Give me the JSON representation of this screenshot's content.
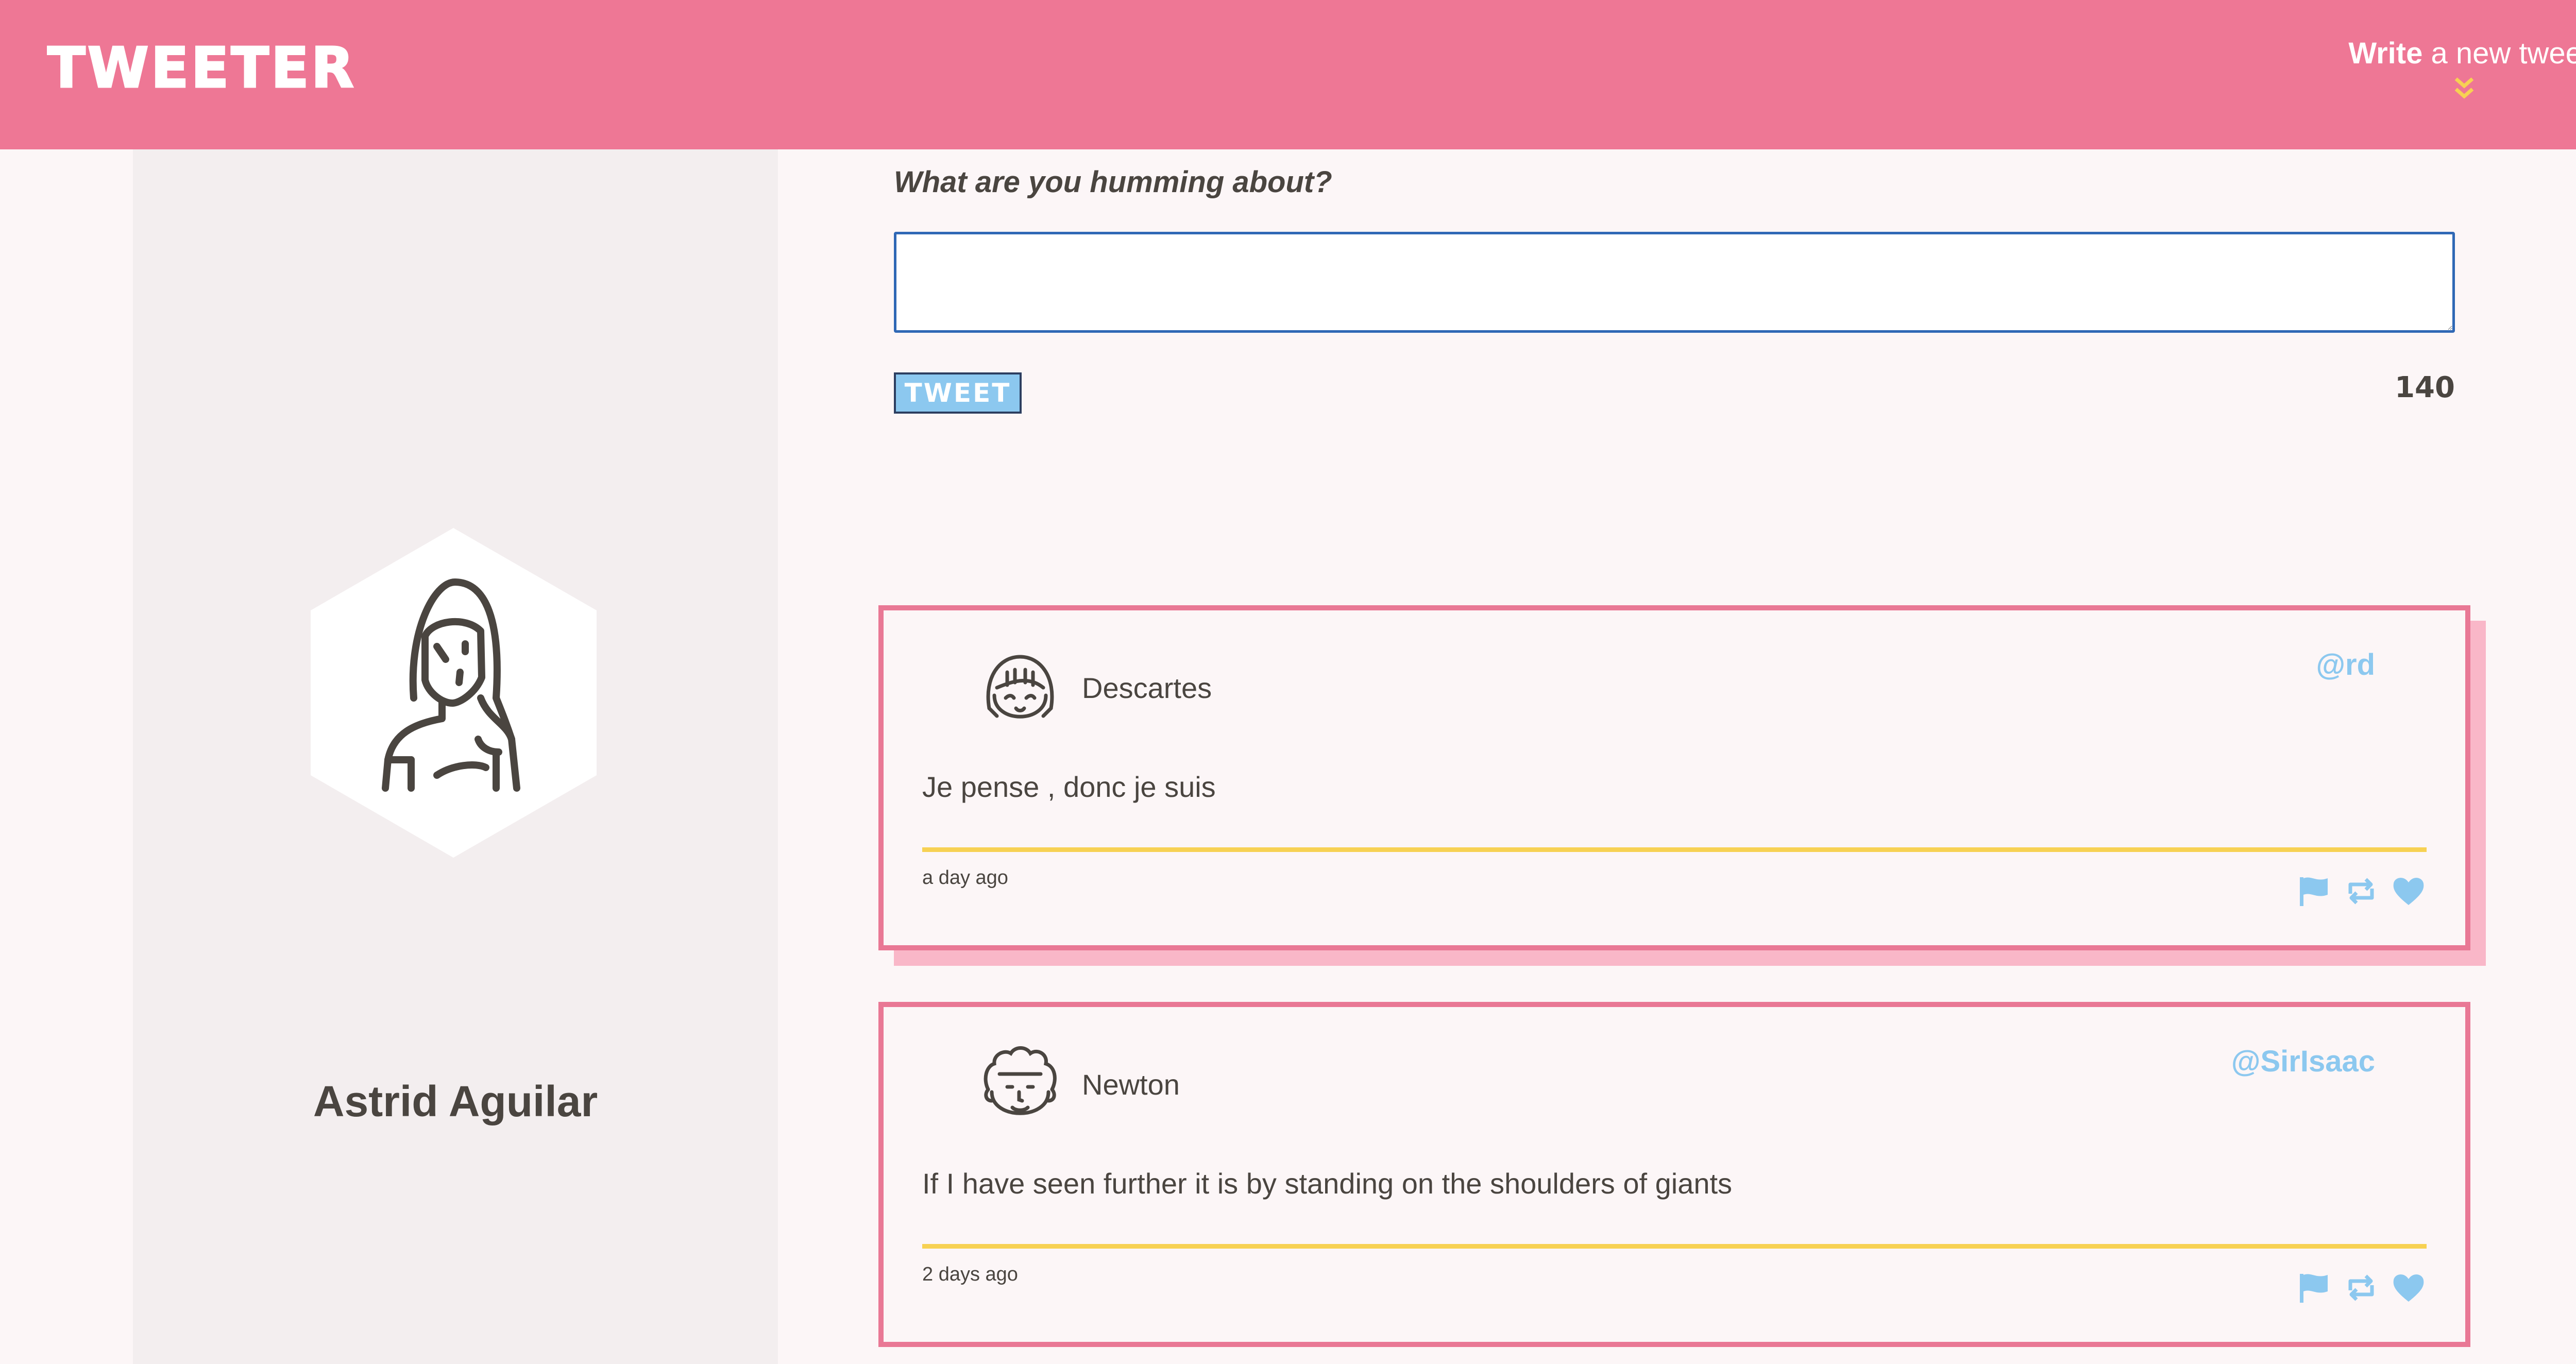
{
  "header": {
    "brand": "TWEETER",
    "compose_toggle_bold": "Write",
    "compose_toggle_rest": " a new tweet"
  },
  "sidebar": {
    "user_name": "Astrid Aguilar"
  },
  "compose": {
    "label": "What are you humming about?",
    "input_value": "",
    "button_label": "TWEET",
    "counter": "140"
  },
  "tweets": [
    {
      "name": "Descartes",
      "handle": "@rd",
      "text": "Je pense , donc je suis",
      "time": "a day ago"
    },
    {
      "name": "Newton",
      "handle": "@SirIsaac",
      "text": "If I have seen further it is by standing on the shoulders of giants",
      "time": "2 days ago"
    }
  ],
  "colors": {
    "header_bg": "#ee7795",
    "accent_blue": "#8cc8ef",
    "divider_yellow": "#f7d153",
    "chevron_yellow": "#f7d153",
    "tweet_border": "#e97895"
  },
  "icons": {
    "action_icons": [
      "flag-icon",
      "retweet-icon",
      "heart-icon"
    ],
    "toggle_icon": "double-chevron-down-icon"
  }
}
